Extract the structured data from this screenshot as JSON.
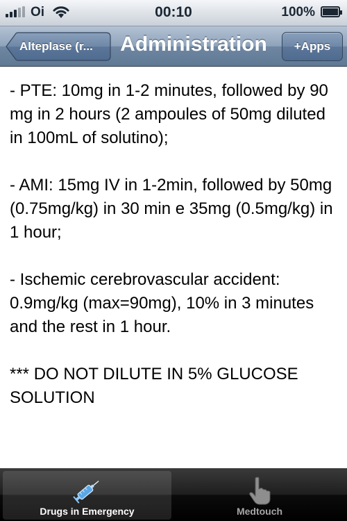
{
  "status_bar": {
    "carrier": "Oi",
    "time": "00:10",
    "battery_percent": "100%"
  },
  "nav": {
    "back_label": "Alteplase (r...",
    "title": "Administration",
    "right_button_label": "+Apps"
  },
  "content": {
    "paragraphs": [
      "- PTE: 10mg in 1-2 minutes, followed by 90 mg in 2 hours (2 ampoules of 50mg diluted in 100mL of solutino);",
      "- AMI: 15mg IV in 1-2min, followed by 50mg (0.75mg/kg) in 30 min e 35mg (0.5mg/kg) in 1 hour;",
      "- Ischemic cerebrovascular accident: 0.9mg/kg (max=90mg), 10% in 3 minutes and the rest in 1 hour.",
      "*** DO NOT DILUTE IN 5% GLUCOSE SOLUTION"
    ]
  },
  "tabbar": {
    "tabs": [
      {
        "label": "Drugs in Emergency",
        "icon": "syringe-icon",
        "selected": true
      },
      {
        "label": "Medtouch",
        "icon": "pointing-hand-icon",
        "selected": false
      }
    ]
  },
  "colors": {
    "nav_blue": "#6f87a2",
    "tabbar_black": "#0b0b0b",
    "text": "#000000"
  }
}
